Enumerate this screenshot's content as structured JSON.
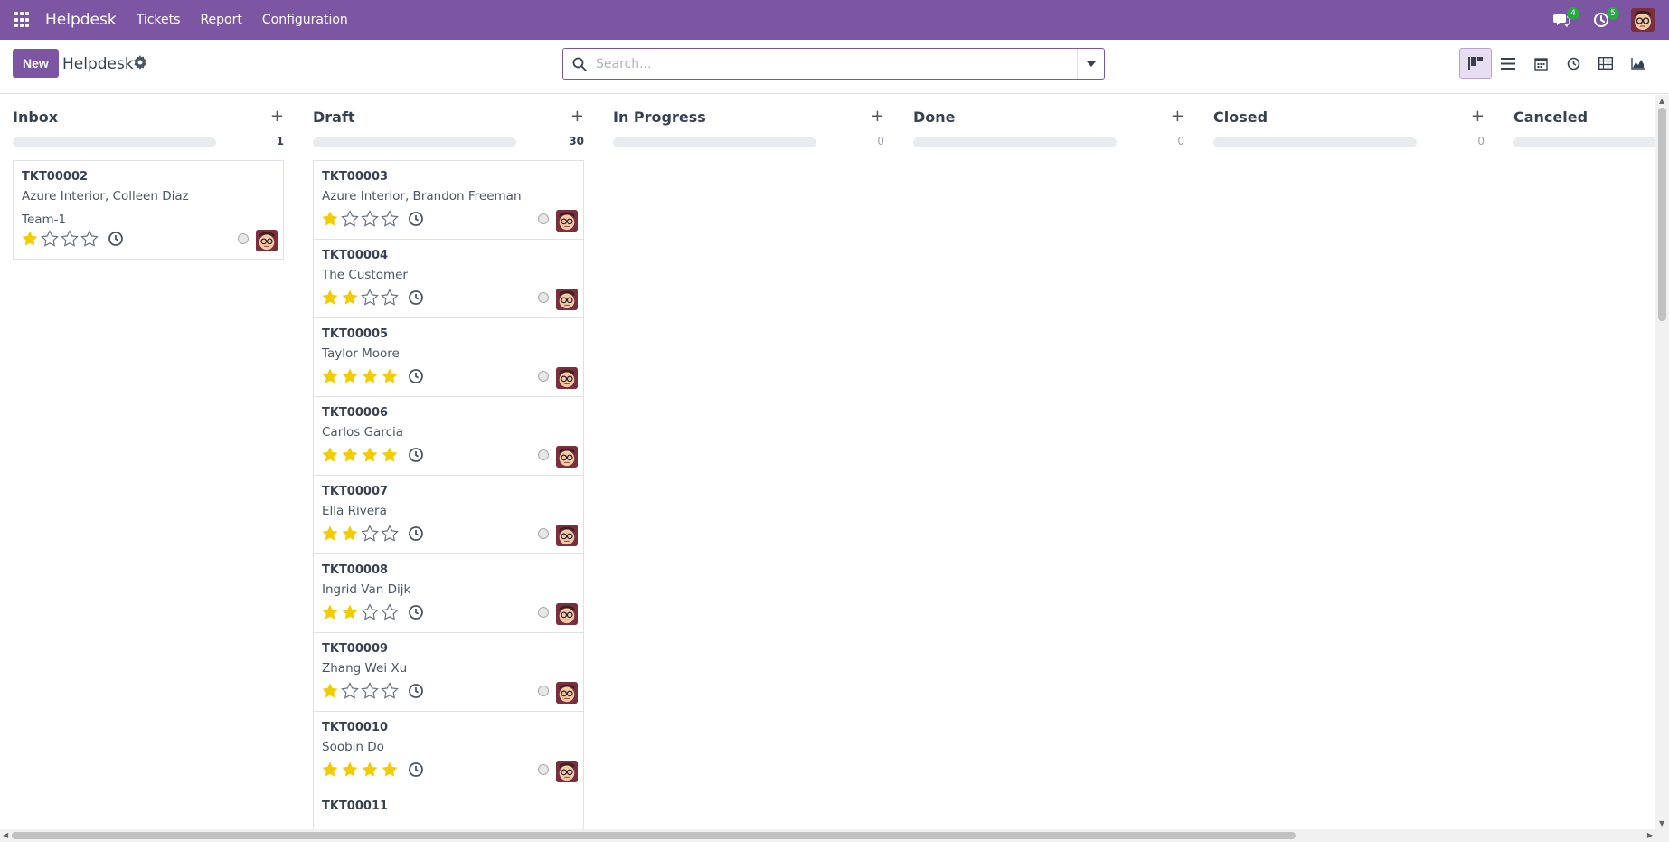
{
  "navbar": {
    "app_name": "Helpdesk",
    "menu": [
      "Tickets",
      "Report",
      "Configuration"
    ],
    "messages_count": "4",
    "activities_count": "5",
    "icons": {
      "apps": "apps-grid-icon",
      "messages": "chat-icon",
      "activities": "clock-icon"
    }
  },
  "control": {
    "new_label": "New",
    "title": "Helpdesk",
    "search_placeholder": "Search...",
    "views": [
      "kanban-view",
      "list-view",
      "calendar-view",
      "activity-view",
      "pivot-view",
      "graph-view"
    ],
    "active_view": "kanban-view"
  },
  "colors": {
    "brand": "#7c56a2",
    "star": "#f3cc00",
    "badge": "#28a745"
  },
  "columns": [
    {
      "title": "Inbox",
      "count": "1",
      "cards": [
        {
          "ref": "TKT00002",
          "customer": "Azure Interior, Colleen Diaz",
          "team": "Team-1",
          "stars": 1
        }
      ]
    },
    {
      "title": "Draft",
      "count": "30",
      "cards": [
        {
          "ref": "TKT00003",
          "customer": "Azure Interior, Brandon Freeman",
          "team": "",
          "stars": 1
        },
        {
          "ref": "TKT00004",
          "customer": "The Customer",
          "team": "",
          "stars": 2
        },
        {
          "ref": "TKT00005",
          "customer": "Taylor Moore",
          "team": "",
          "stars": 4
        },
        {
          "ref": "TKT00006",
          "customer": "Carlos Garcia",
          "team": "",
          "stars": 4
        },
        {
          "ref": "TKT00007",
          "customer": "Ella Rivera",
          "team": "",
          "stars": 2
        },
        {
          "ref": "TKT00008",
          "customer": "Ingrid Van Dijk",
          "team": "",
          "stars": 2
        },
        {
          "ref": "TKT00009",
          "customer": "Zhang Wei Xu",
          "team": "",
          "stars": 1
        },
        {
          "ref": "TKT00010",
          "customer": "Soobin Do",
          "team": "",
          "stars": 4
        },
        {
          "ref": "TKT00011",
          "customer": "",
          "team": "",
          "stars": 0
        }
      ]
    },
    {
      "title": "In Progress",
      "count": "0",
      "cards": []
    },
    {
      "title": "Done",
      "count": "0",
      "cards": []
    },
    {
      "title": "Closed",
      "count": "0",
      "cards": []
    },
    {
      "title": "Canceled",
      "count": "",
      "cards": []
    }
  ]
}
